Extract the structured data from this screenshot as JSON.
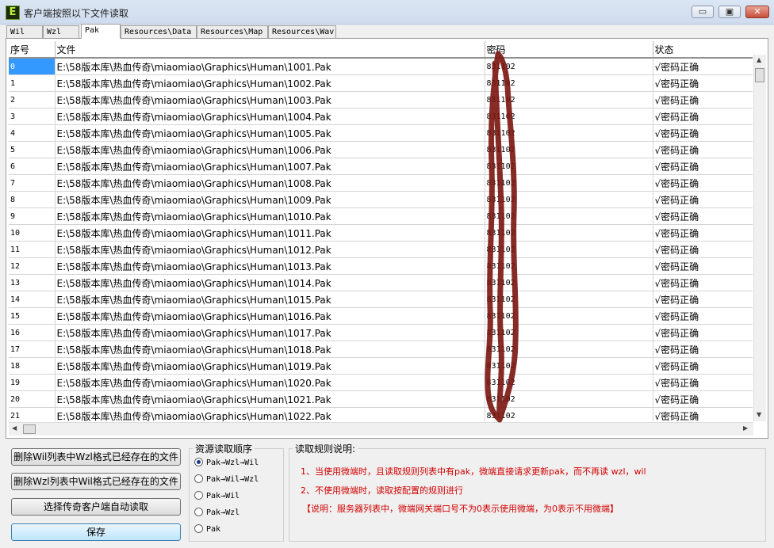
{
  "window": {
    "title": "客户端按照以下文件读取",
    "icon": "app-e-icon",
    "min": "▭",
    "max": "▣",
    "close": "✕"
  },
  "tabs": [
    {
      "label": "Wil"
    },
    {
      "label": "Wzl"
    },
    {
      "label": "Pak",
      "active": true
    },
    {
      "label": "Resources\\Data"
    },
    {
      "label": "Resources\\Map"
    },
    {
      "label": "Resources\\Wav"
    }
  ],
  "table": {
    "headers": [
      "序号",
      "文件",
      "密码",
      "状态"
    ],
    "rows": [
      {
        "id": "0",
        "file": "E:\\58版本库\\热血传奇\\miaomiao\\Graphics\\Human\\1001.Pak",
        "pw": "831102",
        "status": "√密码正确"
      },
      {
        "id": "1",
        "file": "E:\\58版本库\\热血传奇\\miaomiao\\Graphics\\Human\\1002.Pak",
        "pw": "831102",
        "status": "√密码正确"
      },
      {
        "id": "2",
        "file": "E:\\58版本库\\热血传奇\\miaomiao\\Graphics\\Human\\1003.Pak",
        "pw": "831102",
        "status": "√密码正确"
      },
      {
        "id": "3",
        "file": "E:\\58版本库\\热血传奇\\miaomiao\\Graphics\\Human\\1004.Pak",
        "pw": "831102",
        "status": "√密码正确"
      },
      {
        "id": "4",
        "file": "E:\\58版本库\\热血传奇\\miaomiao\\Graphics\\Human\\1005.Pak",
        "pw": "831102",
        "status": "√密码正确"
      },
      {
        "id": "5",
        "file": "E:\\58版本库\\热血传奇\\miaomiao\\Graphics\\Human\\1006.Pak",
        "pw": "831102",
        "status": "√密码正确"
      },
      {
        "id": "6",
        "file": "E:\\58版本库\\热血传奇\\miaomiao\\Graphics\\Human\\1007.Pak",
        "pw": "831102",
        "status": "√密码正确"
      },
      {
        "id": "7",
        "file": "E:\\58版本库\\热血传奇\\miaomiao\\Graphics\\Human\\1008.Pak",
        "pw": "831102",
        "status": "√密码正确"
      },
      {
        "id": "8",
        "file": "E:\\58版本库\\热血传奇\\miaomiao\\Graphics\\Human\\1009.Pak",
        "pw": "831102",
        "status": "√密码正确"
      },
      {
        "id": "9",
        "file": "E:\\58版本库\\热血传奇\\miaomiao\\Graphics\\Human\\1010.Pak",
        "pw": "831102",
        "status": "√密码正确"
      },
      {
        "id": "10",
        "file": "E:\\58版本库\\热血传奇\\miaomiao\\Graphics\\Human\\1011.Pak",
        "pw": "831102",
        "status": "√密码正确"
      },
      {
        "id": "11",
        "file": "E:\\58版本库\\热血传奇\\miaomiao\\Graphics\\Human\\1012.Pak",
        "pw": "831102",
        "status": "√密码正确"
      },
      {
        "id": "12",
        "file": "E:\\58版本库\\热血传奇\\miaomiao\\Graphics\\Human\\1013.Pak",
        "pw": "831102",
        "status": "√密码正确"
      },
      {
        "id": "13",
        "file": "E:\\58版本库\\热血传奇\\miaomiao\\Graphics\\Human\\1014.Pak",
        "pw": "831102",
        "status": "√密码正确"
      },
      {
        "id": "14",
        "file": "E:\\58版本库\\热血传奇\\miaomiao\\Graphics\\Human\\1015.Pak",
        "pw": "831102",
        "status": "√密码正确"
      },
      {
        "id": "15",
        "file": "E:\\58版本库\\热血传奇\\miaomiao\\Graphics\\Human\\1016.Pak",
        "pw": "831102",
        "status": "√密码正确"
      },
      {
        "id": "16",
        "file": "E:\\58版本库\\热血传奇\\miaomiao\\Graphics\\Human\\1017.Pak",
        "pw": "831102",
        "status": "√密码正确"
      },
      {
        "id": "17",
        "file": "E:\\58版本库\\热血传奇\\miaomiao\\Graphics\\Human\\1018.Pak",
        "pw": "831102",
        "status": "√密码正确"
      },
      {
        "id": "18",
        "file": "E:\\58版本库\\热血传奇\\miaomiao\\Graphics\\Human\\1019.Pak",
        "pw": "831102",
        "status": "√密码正确"
      },
      {
        "id": "19",
        "file": "E:\\58版本库\\热血传奇\\miaomiao\\Graphics\\Human\\1020.Pak",
        "pw": "831102",
        "status": "√密码正确"
      },
      {
        "id": "20",
        "file": "E:\\58版本库\\热血传奇\\miaomiao\\Graphics\\Human\\1021.Pak",
        "pw": "831102",
        "status": "√密码正确"
      },
      {
        "id": "21",
        "file": "E:\\58版本库\\热血传奇\\miaomiao\\Graphics\\Human\\1022.Pak",
        "pw": "831102",
        "status": "√密码正确"
      }
    ]
  },
  "scrollbar": {
    "up": "▲",
    "down": "▼",
    "left": "◀",
    "right": "▶"
  },
  "buttons": {
    "delete_wzl": "删除Wil列表中Wzl格式已经存在的文件",
    "delete_wil": "删除Wzl列表中Wil格式已经存在的文件",
    "auto_read": "选择传奇客户端自动读取",
    "save": "保存"
  },
  "order_group": {
    "title": "资源读取顺序",
    "options": [
      {
        "label": "Pak→Wzl→Wil",
        "selected": true
      },
      {
        "label": "Pak→Wil→Wzl",
        "selected": false
      },
      {
        "label": "Pak→Wil",
        "selected": false
      },
      {
        "label": "Pak→Wzl",
        "selected": false
      },
      {
        "label": "Pak",
        "selected": false
      }
    ]
  },
  "rules_group": {
    "title": "读取规则说明:",
    "lines": [
      "1、当使用微端时，且读取规则列表中有pak，微端直接请求更新pak，而不再读 wzl，wil",
      "2、不使用微端时，读取按配置的规则进行",
      "【说明：服务器列表中，微端网关端口号不为0表示使用微端，为0表示不用微端】"
    ]
  },
  "colors": {
    "accent_red": "#d20000",
    "selection": "#3399ff",
    "scribble": "#7a1410"
  }
}
